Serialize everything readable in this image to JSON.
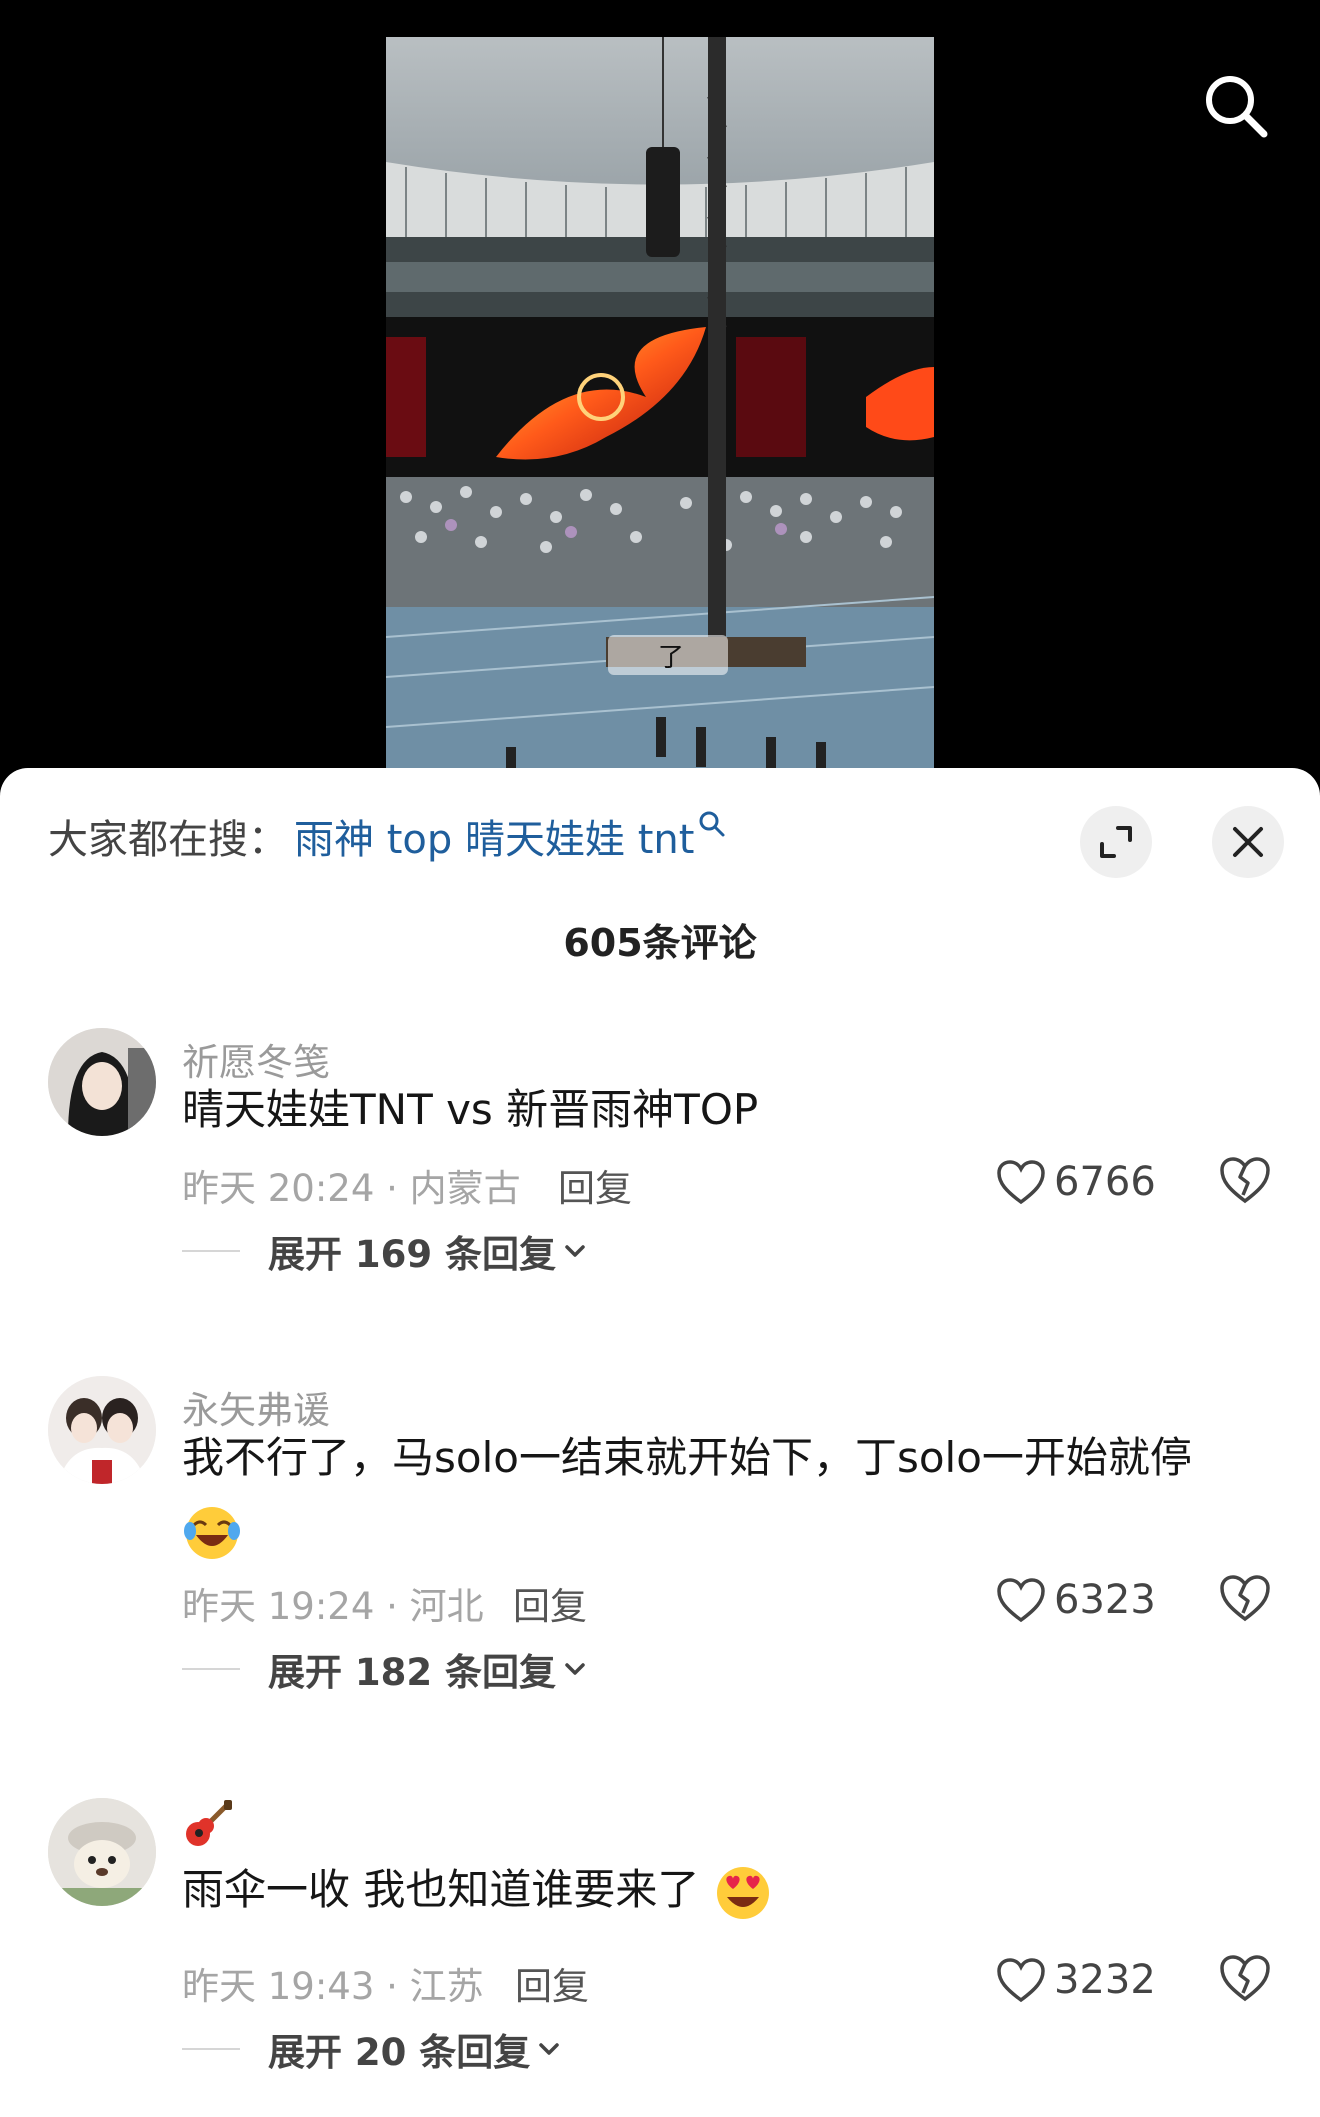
{
  "header": {
    "search_icon": "search-icon"
  },
  "video": {
    "caption_glyph": "了"
  },
  "trend": {
    "prefix": "大家都在搜：",
    "query": "雨神 top 晴天娃娃 tnt"
  },
  "sheet": {
    "comment_count": "605条评论"
  },
  "comments": [
    {
      "user": "祈愿冬笺",
      "text": "晴天娃娃TNT vs 新晋雨神TOP",
      "meta": "昨天 20:24 · 内蒙古",
      "reply": "回复",
      "likes": "6766",
      "expand": "展开 169 条回复"
    },
    {
      "user": "永矢弗谖",
      "text": "我不行了，马solo一结束就开始下，丁solo一开始就停",
      "emoji": "laughing-crying",
      "meta": "昨天 19:24 · 河北",
      "reply": "回复",
      "likes": "6323",
      "expand": "展开 182 条回复"
    },
    {
      "user": "🎸",
      "text": "雨伞一收 我也知道谁要来了",
      "emoji": "heart-eyes",
      "meta": "昨天 19:43 · 江苏",
      "reply": "回复",
      "likes": "3232",
      "expand": "展开 20 条回复"
    }
  ]
}
